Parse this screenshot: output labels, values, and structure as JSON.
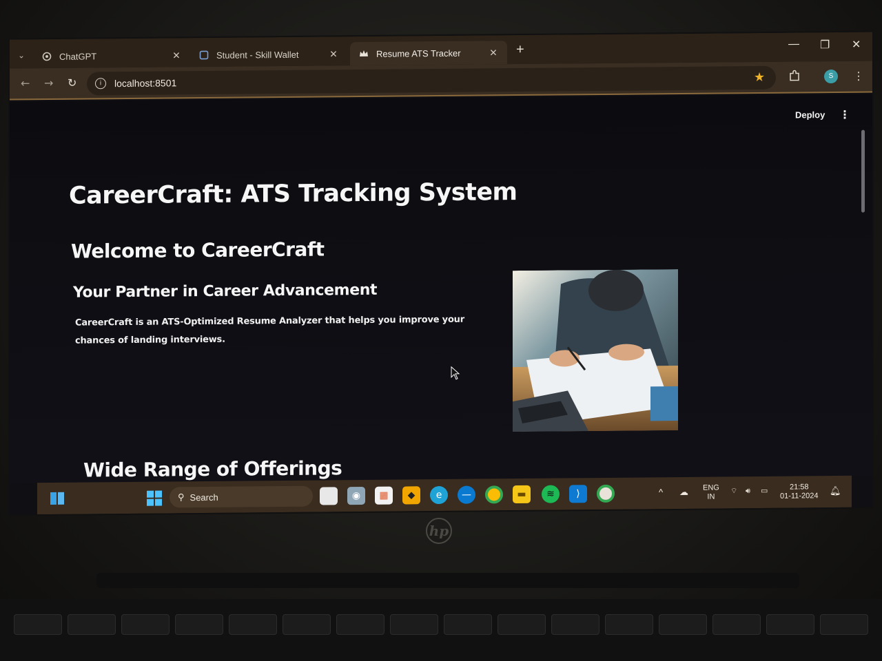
{
  "browser": {
    "tabs": [
      {
        "title": "ChatGPT",
        "icon": "chatgpt-icon"
      },
      {
        "title": "Student - Skill Wallet",
        "icon": "page-icon"
      },
      {
        "title": "Resume ATS Tracker",
        "icon": "streamlit-crown-icon",
        "active": true
      }
    ],
    "url": "localhost:8501",
    "profile_initial": "S"
  },
  "app": {
    "deploy_label": "Deploy",
    "title": "CareerCraft: ATS Tracking System",
    "welcome": "Welcome to CareerCraft",
    "subtitle": "Your Partner in Career Advancement",
    "description": "CareerCraft is an ATS-Optimized Resume Analyzer that helps you improve your chances of landing interviews.",
    "offerings_heading": "Wide Range of Offerings"
  },
  "taskbar": {
    "search_label": "Search",
    "language": "ENG",
    "region": "IN",
    "time": "21:58",
    "date": "01-11-2024"
  },
  "colors": {
    "tabbar": "#2c2217",
    "toolbar": "#3a2e22",
    "page_bg": "#0c0c10",
    "taskbar": "#3a2c1f",
    "star": "#f0b429"
  }
}
